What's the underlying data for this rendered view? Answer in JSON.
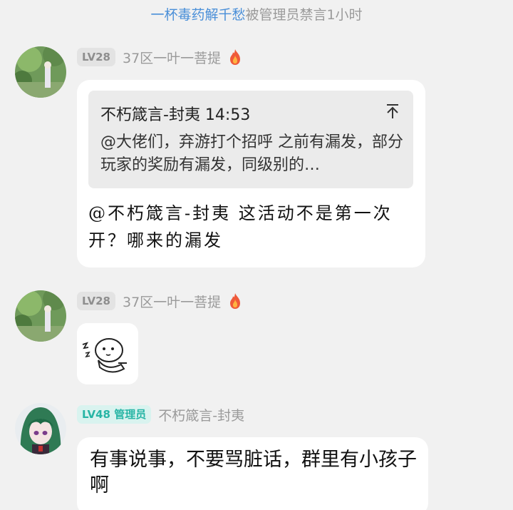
{
  "system_notice": {
    "username": "一杯毒药解千愁",
    "action": "被管理员禁言1小时"
  },
  "messages": [
    {
      "level": "LV28",
      "nickname": "37区一叶一菩提",
      "quote": {
        "author_time": "不朽箴言-封夷 14:53",
        "text": "@大佬们，弃游打个招呼  之前有漏发，部分玩家的奖励有漏发，同级别的…"
      },
      "text": "@不朽箴言-封夷 这活动不是第一次开？哪来的漏发"
    },
    {
      "level": "LV28",
      "nickname": "37区一叶一菩提"
    },
    {
      "level": "LV48",
      "role": "管理员",
      "nickname": "不朽箴言-封夷",
      "text": "有事说事，不要骂脏话，群里有小孩子啊"
    }
  ]
}
